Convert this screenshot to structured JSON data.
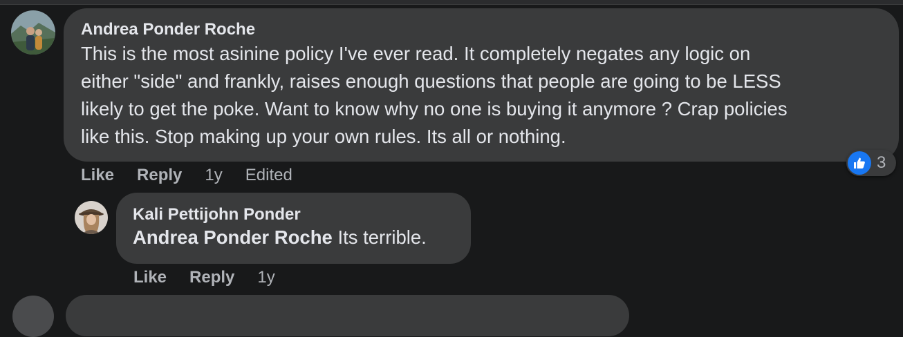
{
  "comment1": {
    "author": "Andrea Ponder Roche",
    "lines": [
      "This is the most asinine policy I've ever read. It completely negates any logic on",
      "either \"side\" and frankly, raises enough questions that people are going to be LESS",
      "likely to get the poke. Want to know why no one is buying it anymore ? Crap policies",
      "like this. Stop making up your own rules. Its all or nothing."
    ],
    "like_label": "Like",
    "reply_label": "Reply",
    "time": "1y",
    "edited_label": "Edited",
    "reaction_count": "3",
    "reaction_icon": "thumbs-up-icon",
    "reaction_color": "#1877f2"
  },
  "comment2": {
    "author": "Kali Pettijohn Ponder",
    "mention": "Andrea Ponder Roche",
    "text": " Its terrible.",
    "like_label": "Like",
    "reply_label": "Reply",
    "time": "1y"
  },
  "colors": {
    "background": "#18191a",
    "bubble": "#3a3b3c",
    "text_primary": "#e4e6eb",
    "text_secondary": "#b0b3b8"
  }
}
